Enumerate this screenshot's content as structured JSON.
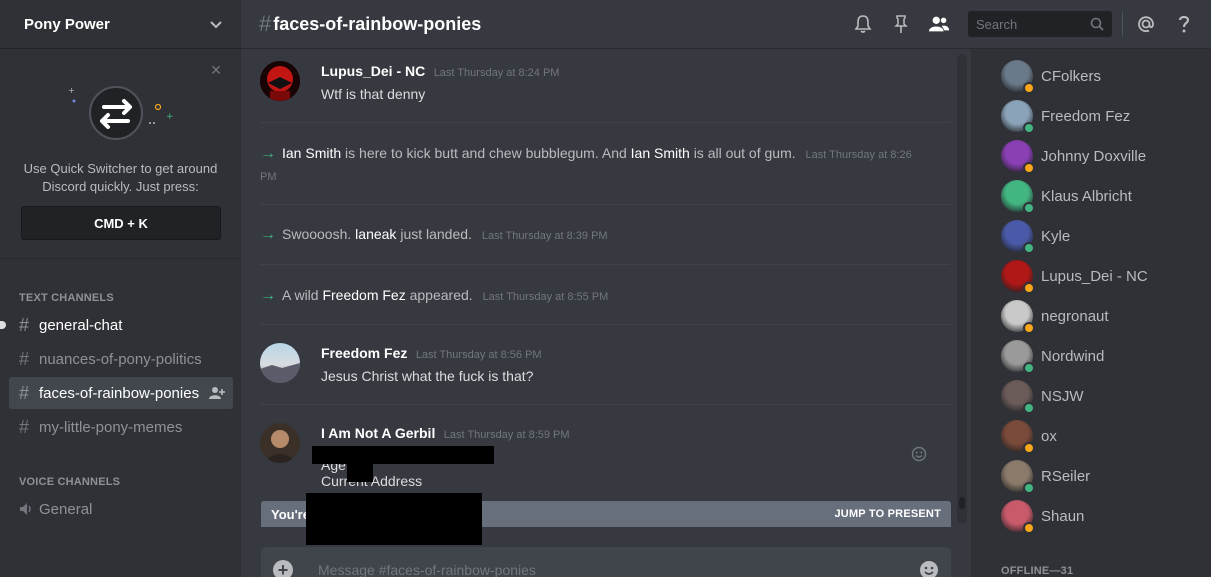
{
  "server": {
    "name": "Pony Power"
  },
  "quick_switcher": {
    "text": "Use Quick Switcher to get around Discord quickly. Just press:",
    "shortcut": "CMD + K"
  },
  "categories": {
    "text": "TEXT CHANNELS",
    "voice": "VOICE CHANNELS"
  },
  "text_channels": [
    {
      "name": "general-chat",
      "state": "unread"
    },
    {
      "name": "nuances-of-pony-politics",
      "state": "normal"
    },
    {
      "name": "faces-of-rainbow-ponies",
      "state": "active"
    },
    {
      "name": "my-little-pony-memes",
      "state": "normal"
    }
  ],
  "voice_channels": [
    {
      "name": "General"
    }
  ],
  "header": {
    "channel": "faces-of-rainbow-ponies",
    "search_placeholder": "Search"
  },
  "messages": {
    "m1": {
      "author": "Lupus_Dei - NC",
      "timestamp": "Last Thursday at 8:24 PM",
      "text": "Wtf is that denny"
    },
    "s1": {
      "user1": "Ian Smith",
      "part1": "is here to kick butt and chew bubblegum. And",
      "user2": "Ian Smith",
      "part2": "is all out of gum.",
      "timestamp": "Last Thursday at 8:26 PM"
    },
    "s2": {
      "part1": "Swoooosh.",
      "user": "laneak",
      "part2": "just landed.",
      "timestamp": "Last Thursday at 8:39 PM"
    },
    "s3": {
      "part1": "A wild",
      "user": "Freedom Fez",
      "part2": "appeared.",
      "timestamp": "Last Thursday at 8:55 PM"
    },
    "m2": {
      "author": "Freedom Fez",
      "timestamp": "Last Thursday at 8:56 PM",
      "text": "Jesus Christ what the fuck is that?"
    },
    "m3": {
      "author": "I Am Not A Gerbil",
      "timestamp": "Last Thursday at 8:59 PM",
      "line1": "Age",
      "line2": "Current Address"
    }
  },
  "jump_bar": {
    "text": "You're",
    "button": "JUMP TO PRESENT"
  },
  "composer": {
    "placeholder": "Message #faces-of-rainbow-ponies"
  },
  "members": [
    {
      "name": "CFolkers",
      "status": "idle",
      "color": "#6b7a8a"
    },
    {
      "name": "Freedom Fez",
      "status": "online",
      "color": "#8aa3b8"
    },
    {
      "name": "Johnny Doxville",
      "status": "idle",
      "color": "#8a3fb5"
    },
    {
      "name": "Klaus Albricht",
      "status": "online",
      "color": "#43b581"
    },
    {
      "name": "Kyle",
      "status": "online",
      "color": "#4a5aa8"
    },
    {
      "name": "Lupus_Dei - NC",
      "status": "idle",
      "color": "#b01818"
    },
    {
      "name": "negronaut",
      "status": "idle",
      "color": "#c9c9c9"
    },
    {
      "name": "Nordwind",
      "status": "online",
      "color": "#9a9a9a"
    },
    {
      "name": "NSJW",
      "status": "online",
      "color": "#6a5a58"
    },
    {
      "name": "ox",
      "status": "idle",
      "color": "#7a4a3a"
    },
    {
      "name": "RSeiler",
      "status": "online",
      "color": "#8a7a6a"
    },
    {
      "name": "Shaun",
      "status": "idle",
      "color": "#c85a6a"
    }
  ],
  "offline_label": "OFFLINE—31",
  "colors": {
    "online": "#43b581",
    "idle": "#faa61a",
    "accent": "#7289da"
  }
}
